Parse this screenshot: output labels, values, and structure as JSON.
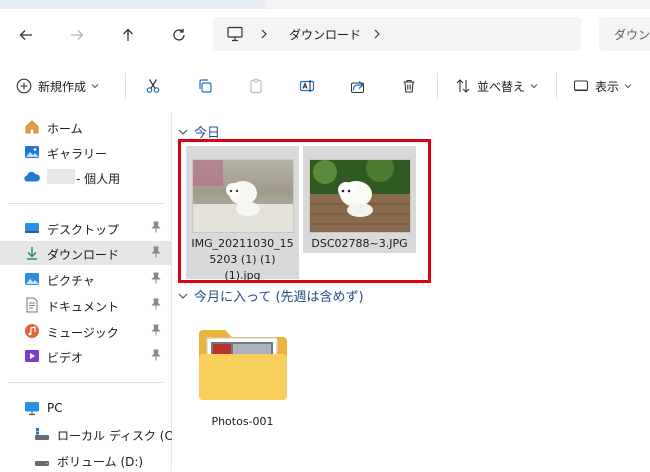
{
  "window": {
    "title": "ダウンロード"
  },
  "address": {
    "root_icon": "computer-icon",
    "current": "ダウンロード"
  },
  "search": {
    "placeholder": "ダウンロ"
  },
  "toolbar": {
    "new_label": "新規作成",
    "sort_label": "並べ替え",
    "view_label": "表示"
  },
  "sidebar": {
    "quick": [
      {
        "label": "ホーム",
        "icon": "home-icon"
      },
      {
        "label": "ギャラリー",
        "icon": "gallery-icon"
      },
      {
        "label": "- 個人用",
        "icon": "onedrive-icon"
      }
    ],
    "pinned": [
      {
        "label": "デスクトップ",
        "icon": "desktop-icon"
      },
      {
        "label": "ダウンロード",
        "icon": "download-icon",
        "selected": true
      },
      {
        "label": "ピクチャ",
        "icon": "pictures-icon"
      },
      {
        "label": "ドキュメント",
        "icon": "documents-icon"
      },
      {
        "label": "ミュージック",
        "icon": "music-icon"
      },
      {
        "label": "ビデオ",
        "icon": "video-icon"
      }
    ],
    "this_pc": {
      "label": "PC",
      "icon": "pc-icon"
    },
    "drives": [
      {
        "label": "ローカル ディスク (C:)",
        "icon": "drive-icon"
      },
      {
        "label": "ボリューム (D:)",
        "icon": "drive-icon"
      }
    ]
  },
  "groups": [
    {
      "header": "今日",
      "files": [
        {
          "name_lines": [
            "IMG_20211030_15",
            "5203 (1) (1)",
            "(1).jpg"
          ],
          "type": "photo"
        },
        {
          "name_lines": [
            "DSC02788~3.JPG"
          ],
          "type": "photo"
        }
      ]
    },
    {
      "header": "今月に入って (先週は含めず)",
      "files": [
        {
          "name_lines": [
            "Photos-001"
          ],
          "type": "folder"
        }
      ]
    }
  ],
  "colors": {
    "accent": "#0067c0",
    "highlight_box": "#e1000f",
    "group_header": "#1f4e8c"
  }
}
